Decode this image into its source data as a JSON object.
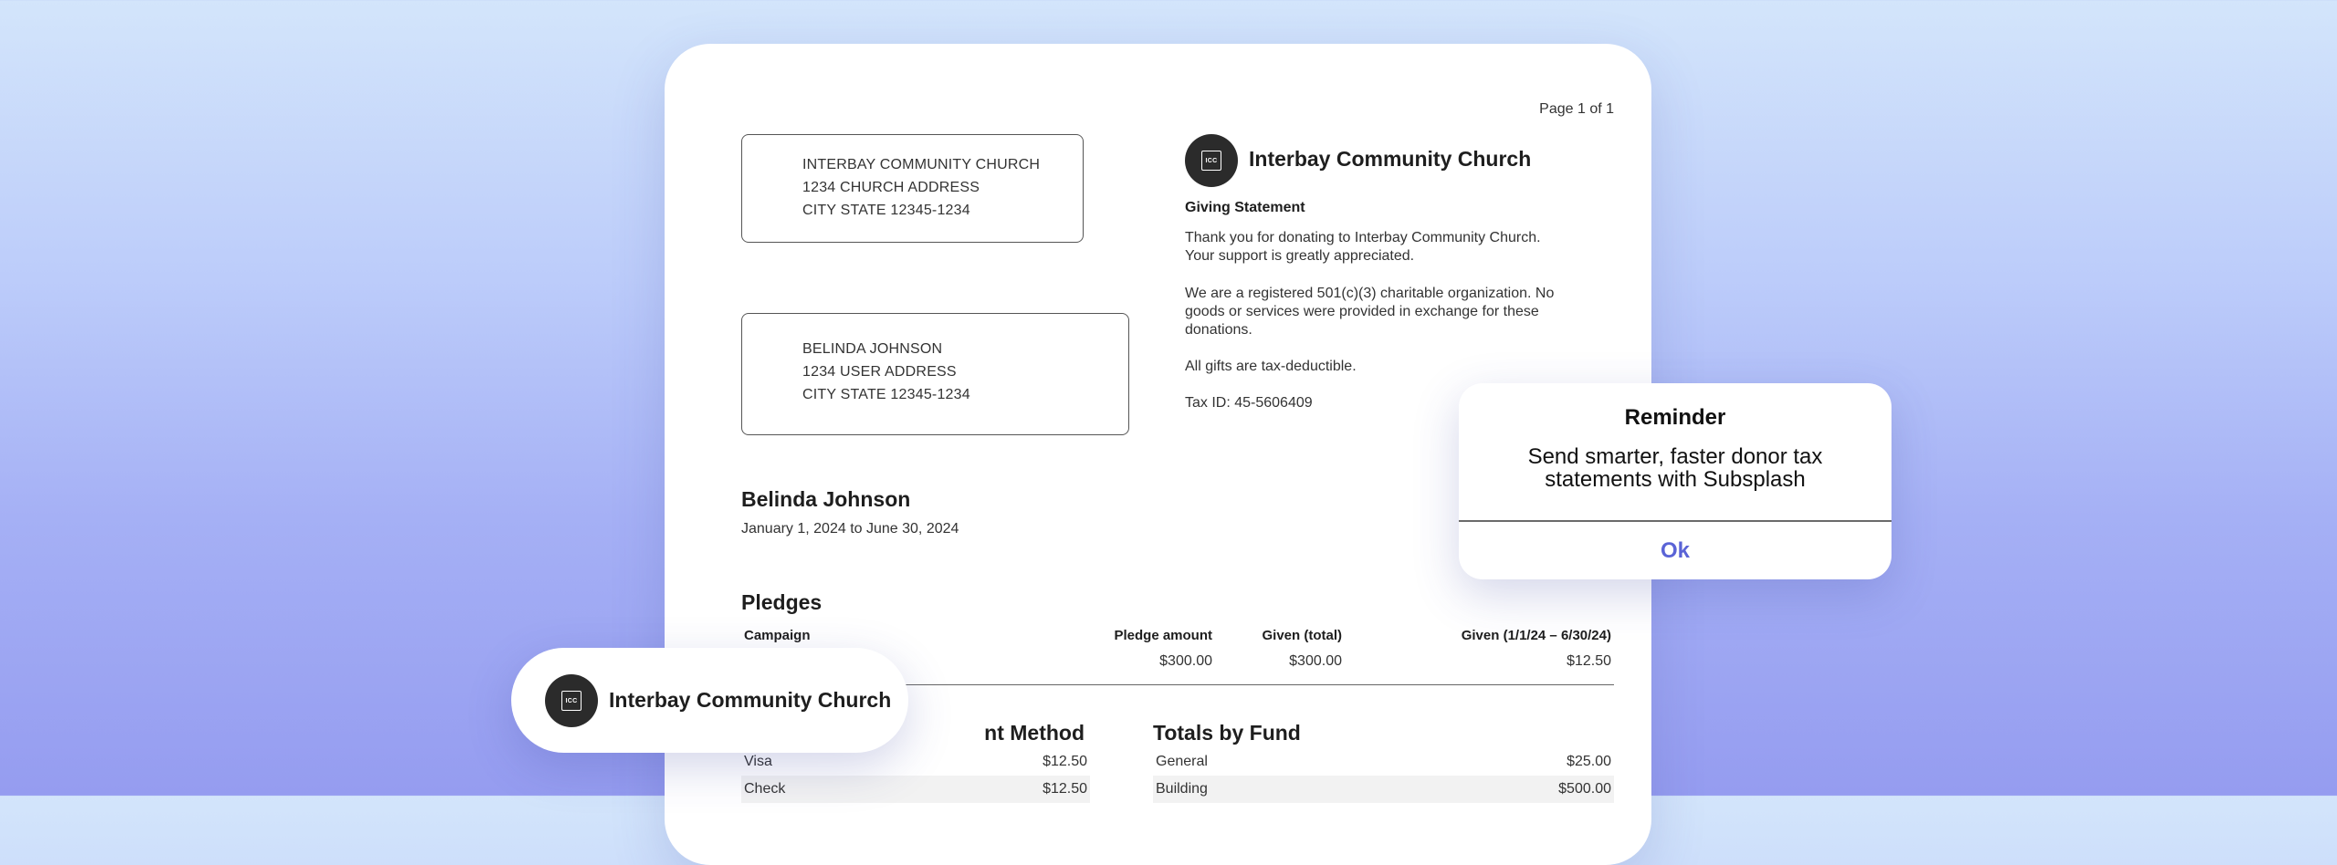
{
  "statement": {
    "page_label": "Page 1 of 1",
    "sender_address": [
      "INTERBAY COMMUNITY CHURCH",
      "1234 CHURCH ADDRESS",
      "CITY STATE 12345-1234"
    ],
    "recipient_address": [
      "BELINDA JOHNSON",
      "1234 USER ADDRESS",
      "CITY STATE 12345-1234"
    ],
    "logo_text": "ICC",
    "church_name": "Interbay Community Church",
    "title": "Giving Statement",
    "paragraphs": [
      "Thank you for donating to Interbay Community Church. Your support is greatly appreciated.",
      "We are a registered 501(c)(3) charitable organization. No goods or services were provided in exchange for these donations.",
      "All gifts are tax-deductible.",
      "Tax ID: 45-5606409"
    ],
    "donor_name": "Belinda Johnson",
    "date_range": "January 1, 2024 to June 30, 2024",
    "pledges": {
      "heading": "Pledges",
      "columns": [
        "Campaign",
        "Pledge amount",
        "Given (total)",
        "Given (1/1/24 – 6/30/24)"
      ],
      "rows": [
        {
          "campaign": "",
          "pledge_amount": "$300.00",
          "given_total": "$300.00",
          "given_period": "$12.50"
        }
      ]
    },
    "totals_by_method": {
      "heading_visible": "nt Method",
      "rows": [
        {
          "label": "Visa",
          "amount": "$12.50"
        },
        {
          "label": "Check",
          "amount": "$12.50"
        }
      ]
    },
    "totals_by_fund": {
      "heading": "Totals by Fund",
      "rows": [
        {
          "label": "General",
          "amount": "$25.00"
        },
        {
          "label": "Building",
          "amount": "$500.00"
        }
      ]
    }
  },
  "reminder": {
    "title": "Reminder",
    "message": "Send smarter, faster donor tax statements with Subsplash",
    "ok_label": "Ok"
  },
  "church_pill": {
    "logo_text": "ICC",
    "name": "Interbay Community Church"
  },
  "colors": {
    "accent": "#5a63d6",
    "logo_bg": "#2b2b2b",
    "background_top": "#d3e5fb",
    "background_bottom": "#959cf0"
  }
}
